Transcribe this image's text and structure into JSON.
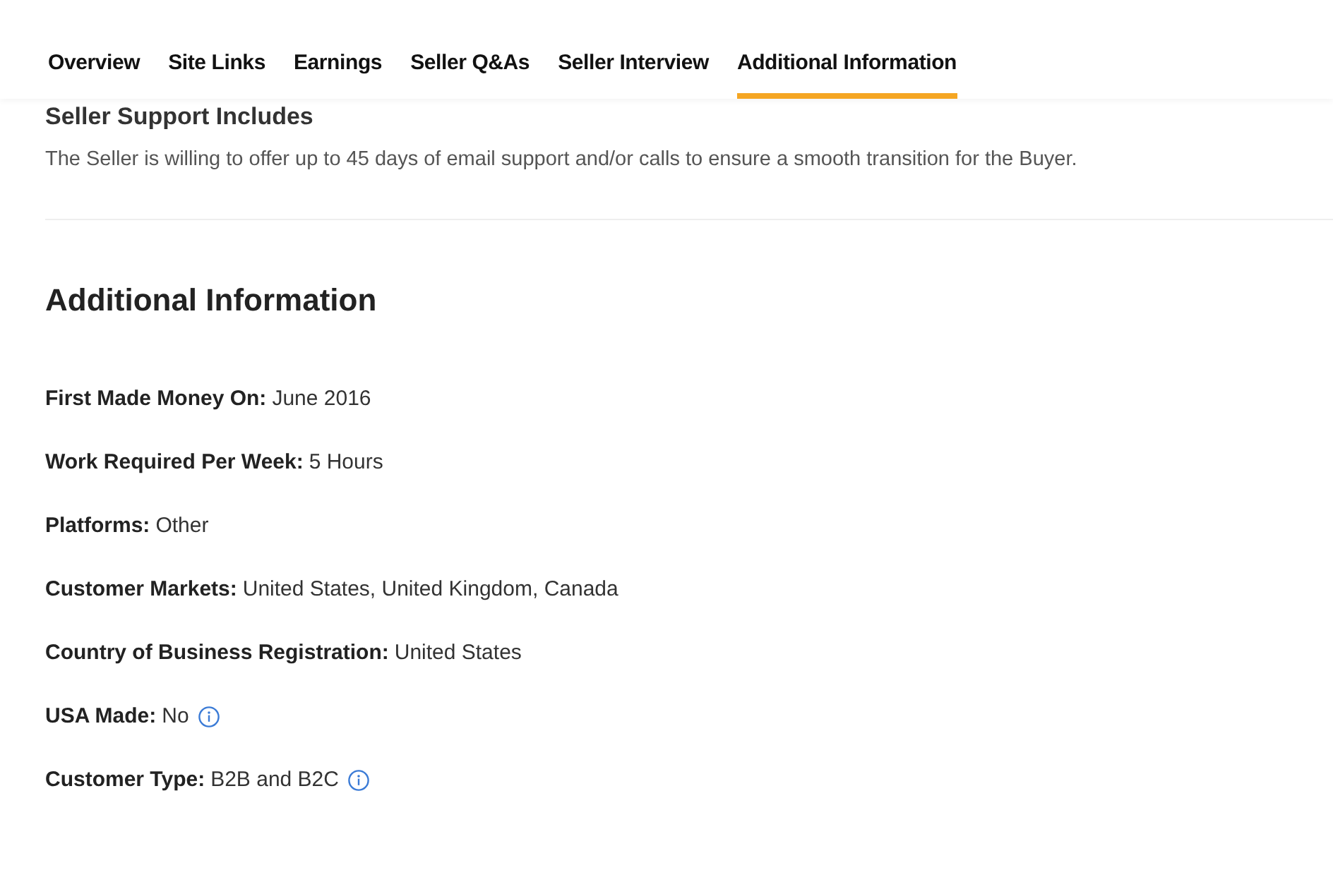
{
  "tabs": [
    {
      "label": "Overview",
      "selected": false
    },
    {
      "label": "Site Links",
      "selected": false
    },
    {
      "label": "Earnings",
      "selected": false
    },
    {
      "label": "Seller Q&As",
      "selected": false
    },
    {
      "label": "Seller Interview",
      "selected": false
    },
    {
      "label": "Additional Information",
      "selected": true
    }
  ],
  "support": {
    "heading": "Seller Support Includes",
    "text": "The Seller is willing to offer up to 45 days of email support and/or calls to ensure a smooth transition for the Buyer."
  },
  "additional": {
    "heading": "Additional Information",
    "rows": [
      {
        "label": "First Made Money On:",
        "value": "June 2016",
        "info": false
      },
      {
        "label": "Work Required Per Week:",
        "value": "5 Hours",
        "info": false
      },
      {
        "label": "Platforms:",
        "value": "Other",
        "info": false
      },
      {
        "label": "Customer Markets:",
        "value": "United States, United Kingdom, Canada",
        "info": false
      },
      {
        "label": "Country of Business Registration:",
        "value": "United States",
        "info": false
      },
      {
        "label": "USA Made:",
        "value": "No",
        "info": true
      },
      {
        "label": "Customer Type:",
        "value": "B2B and B2C",
        "info": true
      }
    ]
  }
}
